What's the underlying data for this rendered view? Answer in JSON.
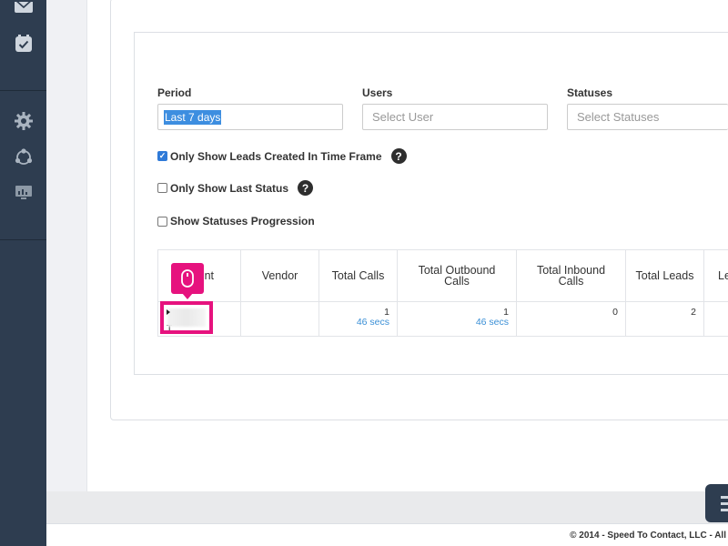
{
  "sidebar": {
    "icons": [
      "mail-icon",
      "calendar-check-icon",
      "settings-icon",
      "network-icon",
      "monitor-chart-icon"
    ]
  },
  "filters": {
    "period": {
      "label": "Period",
      "value": "Last 7 days"
    },
    "users": {
      "label": "Users",
      "placeholder": "Select User"
    },
    "statuses": {
      "label": "Statuses",
      "placeholder": "Select Statuses"
    }
  },
  "options": {
    "only_created": {
      "label": "Only Show Leads Created In Time Frame",
      "checked": true
    },
    "last_status": {
      "label": "Only Show Last Status",
      "checked": false
    },
    "progression": {
      "label": "Show Statuses Progression",
      "checked": false
    },
    "help_glyph": "?"
  },
  "table": {
    "headers": [
      "nt",
      "Vendor",
      "Total Calls",
      "Total Outbound Calls",
      "Total Inbound Calls",
      "Total Leads",
      "Le"
    ],
    "row": {
      "agent_initial": "T",
      "vendor": "",
      "total_calls": "1",
      "total_calls_duration": "46 secs",
      "total_outbound": "1",
      "total_outbound_duration": "46 secs",
      "total_inbound": "0",
      "total_leads": "2"
    }
  },
  "footer": {
    "text": "© 2014 - Speed To Contact, LLC - All"
  },
  "colors": {
    "sidebar": "#2e3d50",
    "highlight": "#e6127e",
    "link": "#3a8fd6"
  }
}
